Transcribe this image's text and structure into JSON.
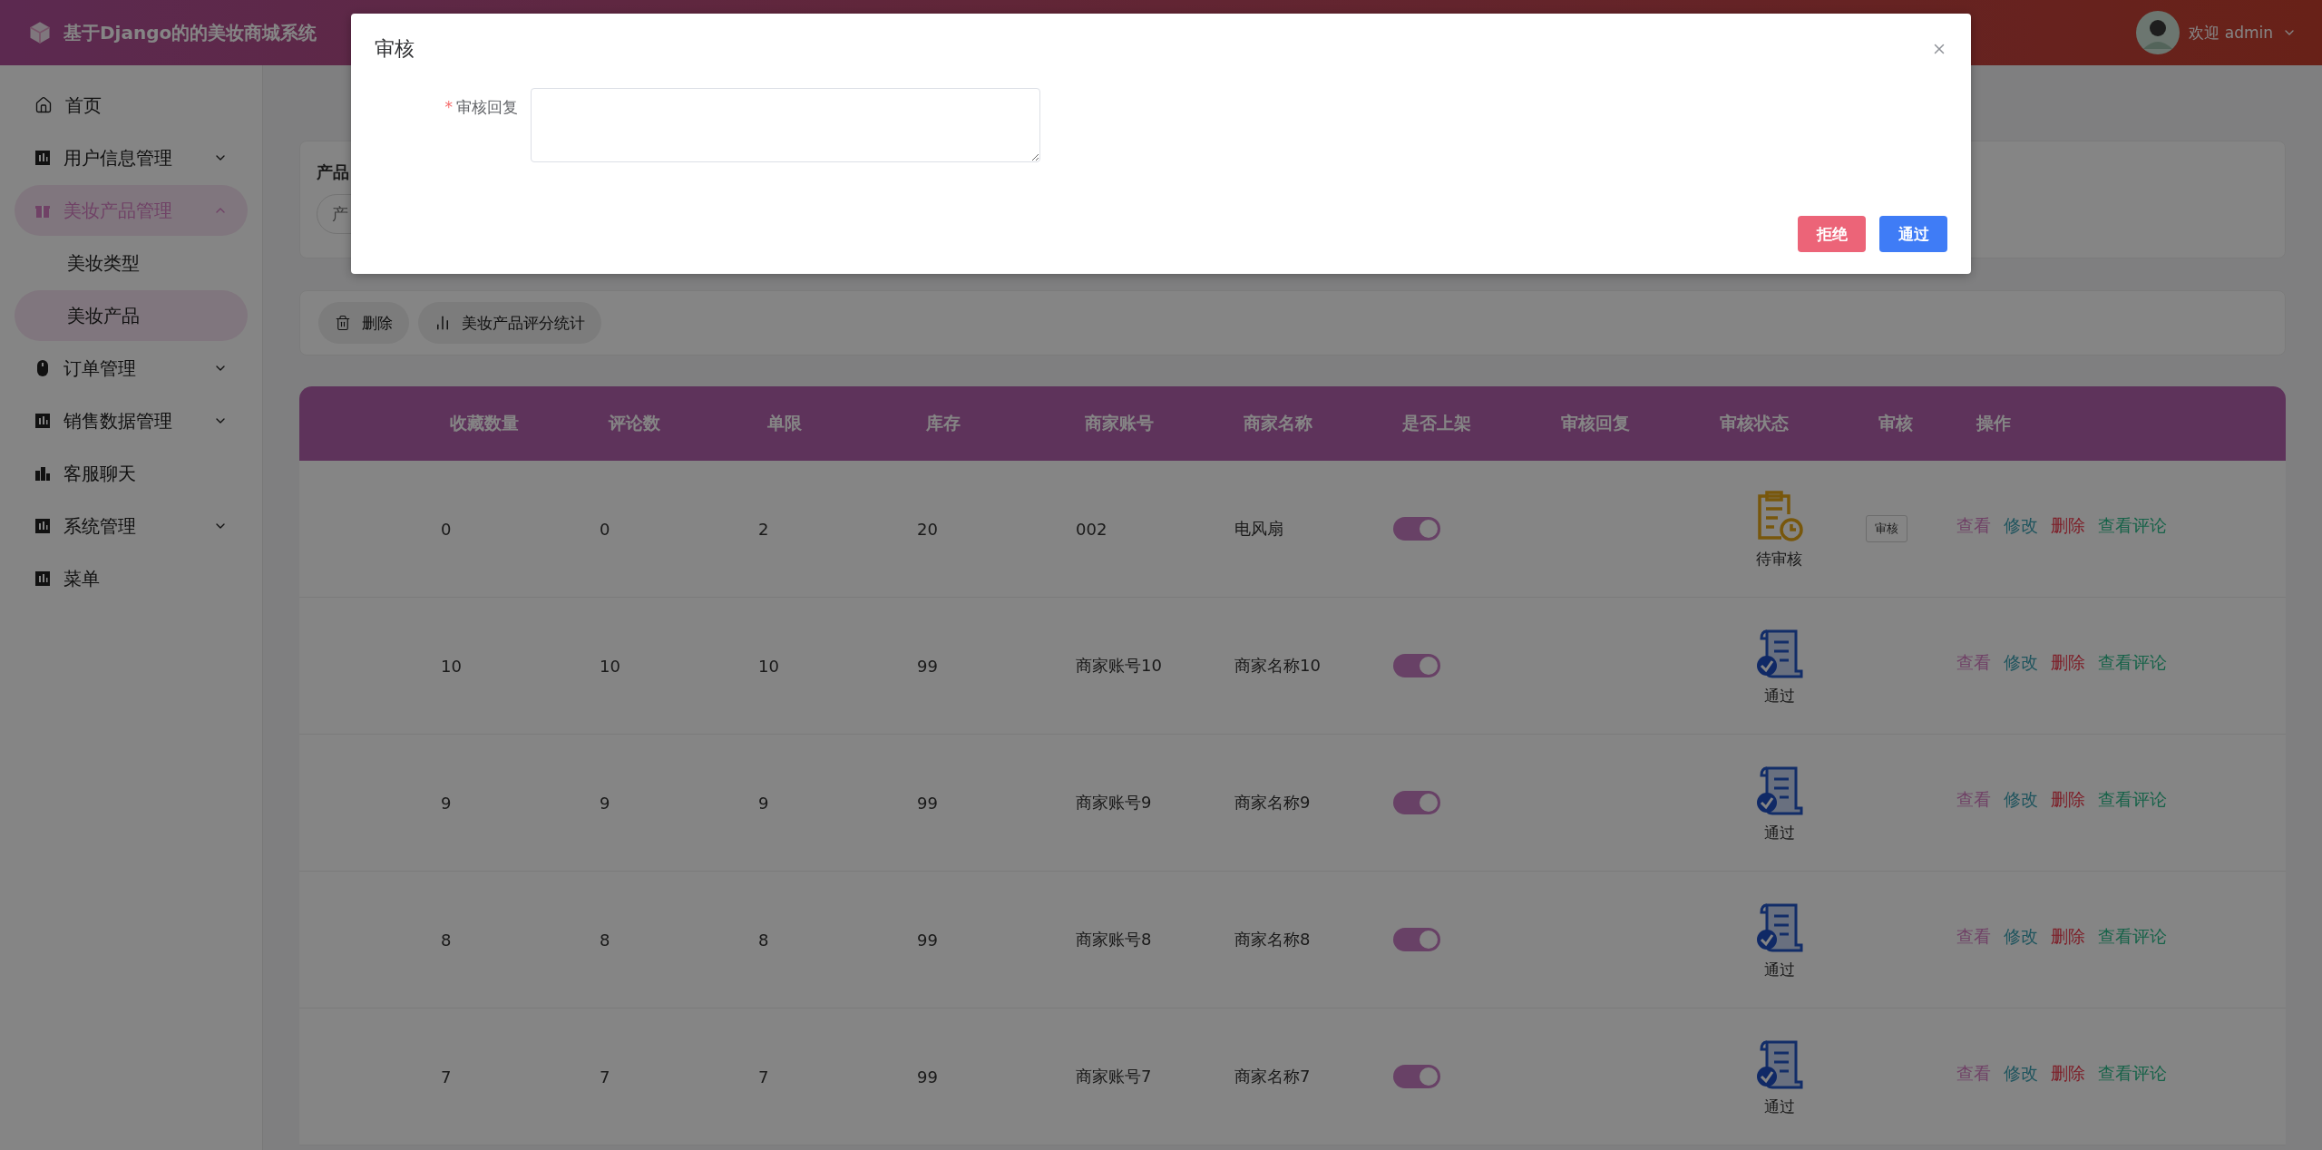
{
  "header": {
    "title": "基于Django的的美妆商城系统",
    "greeting": "欢迎 admin"
  },
  "sidebar": {
    "items": [
      {
        "label": "首页",
        "selected": false
      },
      {
        "label": "用户信息管理",
        "selected": false,
        "expanded": false
      },
      {
        "label": "美妆产品管理",
        "selected": true,
        "expanded": true,
        "children": [
          {
            "label": "美妆类型",
            "selected": false
          },
          {
            "label": "美妆产品",
            "selected": true
          }
        ]
      },
      {
        "label": "订单管理",
        "selected": false,
        "expanded": false
      },
      {
        "label": "销售数据管理",
        "selected": false,
        "expanded": false
      },
      {
        "label": "客服聊天",
        "selected": false
      },
      {
        "label": "系统管理",
        "selected": false,
        "expanded": false
      },
      {
        "label": "菜单",
        "selected": false
      }
    ]
  },
  "search": {
    "label": "产品",
    "placeholder": "产"
  },
  "toolbar": {
    "buttons": [
      {
        "label": "删除",
        "kind": "delete"
      },
      {
        "label": "美妆产品评分统计",
        "kind": "chart"
      }
    ]
  },
  "table": {
    "columns": [
      "收藏数量",
      "评论数",
      "单限",
      "库存",
      "商家账号",
      "商家名称",
      "是否上架",
      "审核回复",
      "审核状态",
      "审核",
      "操作"
    ],
    "rows": [
      {
        "cells": [
          "0",
          "0",
          "2",
          "20",
          "002",
          "电风扇"
        ],
        "on": true,
        "status": {
          "kind": "pending",
          "label": "待审核"
        },
        "review": "审核",
        "actions": [
          {
            "label": "查看",
            "kind": "view"
          },
          {
            "label": "修改",
            "kind": "edit"
          },
          {
            "label": "删除",
            "kind": "delete"
          },
          {
            "label": "查看评论",
            "kind": "comments"
          }
        ]
      },
      {
        "cells": [
          "10",
          "10",
          "10",
          "99",
          "商家账号10",
          "商家名称10"
        ],
        "on": true,
        "status": {
          "kind": "approved",
          "label": "通过"
        },
        "actions": [
          {
            "label": "查看",
            "kind": "view"
          },
          {
            "label": "修改",
            "kind": "edit"
          },
          {
            "label": "删除",
            "kind": "delete"
          },
          {
            "label": "查看评论",
            "kind": "comments"
          }
        ]
      },
      {
        "cells": [
          "9",
          "9",
          "9",
          "99",
          "商家账号9",
          "商家名称9"
        ],
        "on": true,
        "status": {
          "kind": "approved",
          "label": "通过"
        },
        "actions": [
          {
            "label": "查看",
            "kind": "view"
          },
          {
            "label": "修改",
            "kind": "edit"
          },
          {
            "label": "删除",
            "kind": "delete"
          },
          {
            "label": "查看评论",
            "kind": "comments"
          }
        ]
      },
      {
        "cells": [
          "8",
          "8",
          "8",
          "99",
          "商家账号8",
          "商家名称8"
        ],
        "on": true,
        "status": {
          "kind": "approved",
          "label": "通过"
        },
        "actions": [
          {
            "label": "查看",
            "kind": "view"
          },
          {
            "label": "修改",
            "kind": "edit"
          },
          {
            "label": "删除",
            "kind": "delete"
          },
          {
            "label": "查看评论",
            "kind": "comments"
          }
        ]
      },
      {
        "cells": [
          "7",
          "7",
          "7",
          "99",
          "商家账号7",
          "商家名称7"
        ],
        "on": true,
        "status": {
          "kind": "approved",
          "label": "通过"
        },
        "actions": [
          {
            "label": "查看",
            "kind": "view"
          },
          {
            "label": "修改",
            "kind": "edit"
          },
          {
            "label": "删除",
            "kind": "delete"
          },
          {
            "label": "查看评论",
            "kind": "comments"
          }
        ]
      }
    ]
  },
  "modal": {
    "title": "审核",
    "field": {
      "required_mark": "*",
      "label": "审核回复"
    },
    "buttons": [
      {
        "label": "拒绝",
        "kind": "danger"
      },
      {
        "label": "通过",
        "kind": "primary"
      }
    ]
  }
}
